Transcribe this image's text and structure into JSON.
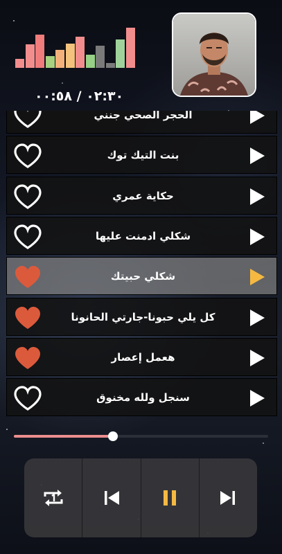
{
  "now_playing": {
    "elapsed": "٠٠:٥٨",
    "total": "٠٢:٣٠",
    "progress": 0.39
  },
  "equalizer": {
    "levels": [
      0.22,
      0.58,
      0.82,
      0.3,
      0.45,
      0.6,
      0.78,
      0.32,
      0.55,
      0.12,
      0.7,
      1.0
    ],
    "colors": [
      "#f28d8d",
      "#f28d8d",
      "#f07c7c",
      "#a7d07f",
      "#f4b07b",
      "#f4c27c",
      "#f28d8d",
      "#97d086",
      "#7a7a7a",
      "#7a7a7a",
      "#9fd29b",
      "#f28d8d"
    ]
  },
  "playlist": [
    {
      "title": "الحجر الصحي جنني",
      "liked": false,
      "active": false
    },
    {
      "title": "بنت التيك توك",
      "liked": false,
      "active": false
    },
    {
      "title": "حكاية عمري",
      "liked": false,
      "active": false
    },
    {
      "title": "شكلي ادمنت عليها",
      "liked": false,
      "active": false
    },
    {
      "title": "شكلي حبيتك",
      "liked": true,
      "active": true
    },
    {
      "title": "كل يلي حبونا-جارتي الحانونا",
      "liked": true,
      "active": false
    },
    {
      "title": "هعمل إعصار",
      "liked": true,
      "active": false
    },
    {
      "title": "سنجل ولله مخنوق",
      "liked": false,
      "active": false
    }
  ],
  "controls": {
    "buttons": [
      "repeat-one-icon",
      "previous-icon",
      "pause-icon",
      "next-icon"
    ]
  },
  "colors": {
    "heart_liked": "#dc5a3c",
    "play_active": "#f5b942",
    "pause": "#f5b942",
    "seek_fill": "#ec8e8e"
  }
}
